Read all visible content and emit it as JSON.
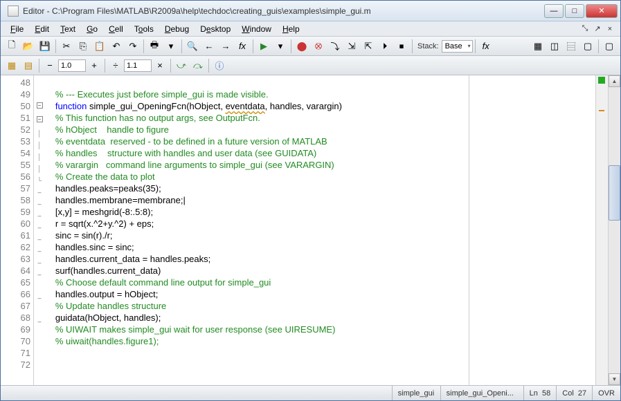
{
  "window": {
    "title": "Editor - C:\\Program Files\\MATLAB\\R2009a\\help\\techdoc\\creating_guis\\examples\\simple_gui.m"
  },
  "menu": {
    "file": "File",
    "edit": "Edit",
    "text": "Text",
    "go": "Go",
    "cell": "Cell",
    "tools": "Tools",
    "debug": "Debug",
    "desktop": "Desktop",
    "window": "Window",
    "help": "Help"
  },
  "toolbar": {
    "stack_label": "Stack:",
    "stack_value": "Base",
    "fx": "fx"
  },
  "toolbar2": {
    "val1": "1.0",
    "val2": "1.1"
  },
  "code": {
    "first_line": 48,
    "lines": [
      {
        "n": 48,
        "fold": "",
        "dash": "",
        "segs": []
      },
      {
        "n": 49,
        "fold": "",
        "dash": "",
        "segs": [
          {
            "cls": "c-comment",
            "t": "% --- Executes just before simple_gui is made visible."
          }
        ]
      },
      {
        "n": 50,
        "fold": "box-",
        "dash": "",
        "segs": [
          {
            "cls": "c-keyword",
            "t": "function"
          },
          {
            "cls": "",
            "t": " simple_gui_OpeningFcn(hObject, "
          },
          {
            "cls": "c-warn",
            "t": "eventdata"
          },
          {
            "cls": "",
            "t": ", handles, varargin)"
          }
        ]
      },
      {
        "n": 51,
        "fold": "box-",
        "dash": "",
        "segs": [
          {
            "cls": "c-comment",
            "t": "% This function has no output args, see OutputFcn."
          }
        ]
      },
      {
        "n": 52,
        "fold": "|",
        "dash": "",
        "segs": [
          {
            "cls": "c-comment",
            "t": "% hObject    handle to figure"
          }
        ]
      },
      {
        "n": 53,
        "fold": "|",
        "dash": "",
        "segs": [
          {
            "cls": "c-comment",
            "t": "% eventdata  reserved - to be defined in a future version of MATLAB"
          }
        ]
      },
      {
        "n": 54,
        "fold": "|",
        "dash": "",
        "segs": [
          {
            "cls": "c-comment",
            "t": "% handles    structure with handles and user data (see GUIDATA)"
          }
        ]
      },
      {
        "n": 55,
        "fold": "|",
        "dash": "",
        "segs": [
          {
            "cls": "c-comment",
            "t": "% varargin   command line arguments to simple_gui (see VARARGIN)"
          }
        ]
      },
      {
        "n": 56,
        "fold": "L",
        "dash": "",
        "segs": [
          {
            "cls": "c-comment",
            "t": "% Create the data to plot"
          }
        ]
      },
      {
        "n": 57,
        "fold": "",
        "dash": "-",
        "segs": [
          {
            "cls": "",
            "t": "handles.peaks=peaks(35);"
          }
        ]
      },
      {
        "n": 58,
        "fold": "",
        "dash": "-",
        "segs": [
          {
            "cls": "",
            "t": "handles.membrane=membrane;"
          }
        ],
        "cursor": true
      },
      {
        "n": 59,
        "fold": "",
        "dash": "-",
        "segs": [
          {
            "cls": "",
            "t": "[x,y] = meshgrid(-8:.5:8);"
          }
        ]
      },
      {
        "n": 60,
        "fold": "",
        "dash": "-",
        "segs": [
          {
            "cls": "",
            "t": "r = sqrt(x.^2+y.^2) + eps;"
          }
        ]
      },
      {
        "n": 61,
        "fold": "",
        "dash": "-",
        "segs": [
          {
            "cls": "",
            "t": "sinc = sin(r)./r;"
          }
        ]
      },
      {
        "n": 62,
        "fold": "",
        "dash": "-",
        "segs": [
          {
            "cls": "",
            "t": "handles.sinc = sinc;"
          }
        ]
      },
      {
        "n": 63,
        "fold": "",
        "dash": "-",
        "segs": [
          {
            "cls": "",
            "t": "handles.current_data = handles.peaks;"
          }
        ]
      },
      {
        "n": 64,
        "fold": "",
        "dash": "-",
        "segs": [
          {
            "cls": "",
            "t": "surf(handles.current_data)"
          }
        ]
      },
      {
        "n": 65,
        "fold": "",
        "dash": "",
        "segs": [
          {
            "cls": "c-comment",
            "t": "% Choose default command line output for simple_gui"
          }
        ]
      },
      {
        "n": 66,
        "fold": "",
        "dash": "-",
        "segs": [
          {
            "cls": "",
            "t": "handles.output = hObject;"
          }
        ]
      },
      {
        "n": 67,
        "fold": "",
        "dash": "",
        "segs": [
          {
            "cls": "c-comment",
            "t": "% Update handles structure"
          }
        ]
      },
      {
        "n": 68,
        "fold": "",
        "dash": "-",
        "segs": [
          {
            "cls": "",
            "t": "guidata(hObject, handles);"
          }
        ]
      },
      {
        "n": 69,
        "fold": "",
        "dash": "",
        "segs": [
          {
            "cls": "c-comment",
            "t": "% UIWAIT makes simple_gui wait for user response (see UIRESUME)"
          }
        ]
      },
      {
        "n": 70,
        "fold": "",
        "dash": "",
        "segs": [
          {
            "cls": "c-comment",
            "t": "% uiwait(handles.figure1);"
          }
        ]
      },
      {
        "n": 71,
        "fold": "",
        "dash": "",
        "segs": []
      },
      {
        "n": 72,
        "fold": "",
        "dash": "",
        "segs": []
      }
    ]
  },
  "status": {
    "doc": "simple_gui",
    "func": "simple_gui_Openi...",
    "ln_label": "Ln",
    "ln": "58",
    "col_label": "Col",
    "col": "27",
    "ovr": "OVR"
  }
}
